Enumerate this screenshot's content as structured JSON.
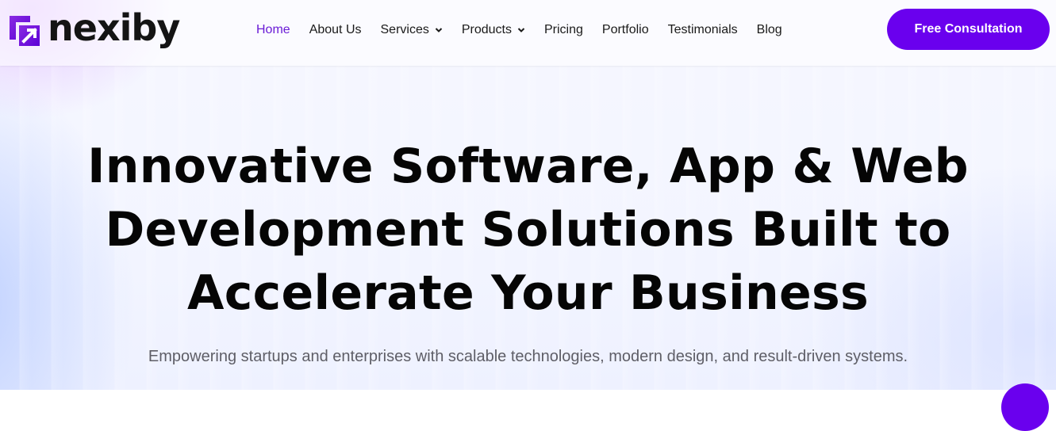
{
  "brand": {
    "name": "nexiby",
    "logo_icon": "arrow-square-icon",
    "accent_color": "#6a00ee"
  },
  "nav": {
    "items": [
      {
        "label": "Home",
        "active": true,
        "has_dropdown": false
      },
      {
        "label": "About Us",
        "active": false,
        "has_dropdown": false
      },
      {
        "label": "Services",
        "active": false,
        "has_dropdown": true
      },
      {
        "label": "Products",
        "active": false,
        "has_dropdown": true
      },
      {
        "label": "Pricing",
        "active": false,
        "has_dropdown": false
      },
      {
        "label": "Portfolio",
        "active": false,
        "has_dropdown": false
      },
      {
        "label": "Testimonials",
        "active": false,
        "has_dropdown": false
      },
      {
        "label": "Blog",
        "active": false,
        "has_dropdown": false
      }
    ],
    "dropdown_icon": "chevron-down-icon"
  },
  "cta": {
    "label": "Free Consultation"
  },
  "hero": {
    "title_lines": [
      "Innovative Software, App & Web",
      "Development Solutions Built to",
      "Accelerate Your Business"
    ],
    "subtitle": "Empowering startups and enterprises with scalable technologies, modern design, and result-driven systems."
  },
  "chat_widget": {
    "icon": "chat-bubble-icon"
  }
}
